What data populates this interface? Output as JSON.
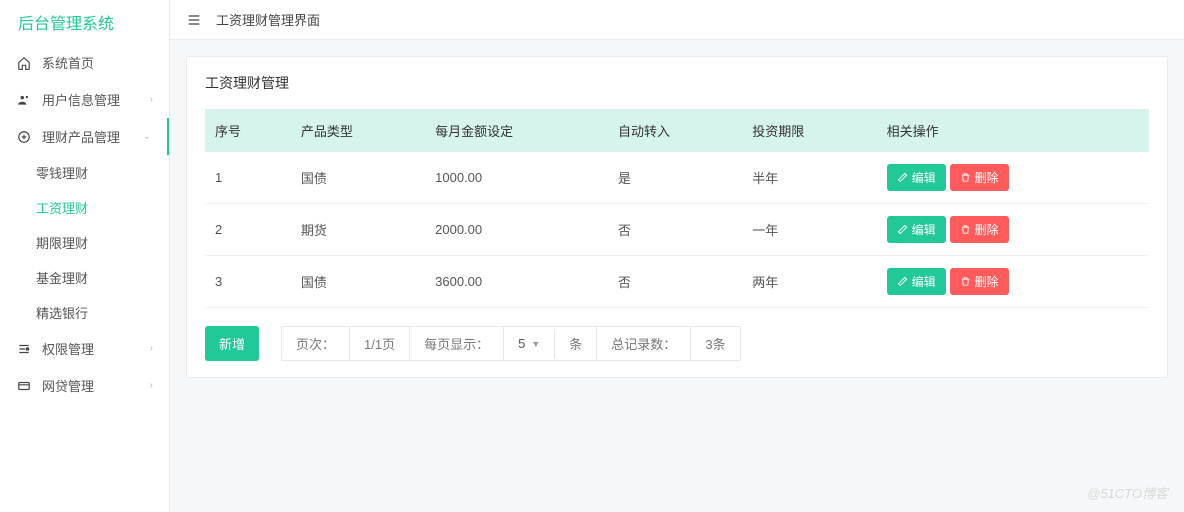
{
  "brand": "后台管理系统",
  "topbar": {
    "title": "工资理财管理界面"
  },
  "sidebar": {
    "home": "系统首页",
    "user": "用户信息管理",
    "product": "理财产品管理",
    "product_children": {
      "lingqian": "零钱理财",
      "gongzi": "工资理财",
      "qixian": "期限理财",
      "jijin": "基金理财",
      "jingxuan": "精选银行"
    },
    "perm": "权限管理",
    "loan": "网贷管理"
  },
  "card": {
    "title": "工资理财管理",
    "headers": {
      "seq": "序号",
      "type": "产品类型",
      "amount": "每月金额设定",
      "auto": "自动转入",
      "period": "投资期限",
      "ops": "相关操作"
    },
    "rows": [
      {
        "seq": "1",
        "type": "国债",
        "amount": "1000.00",
        "auto": "是",
        "period": "半年"
      },
      {
        "seq": "2",
        "type": "期货",
        "amount": "2000.00",
        "auto": "否",
        "period": "一年"
      },
      {
        "seq": "3",
        "type": "国债",
        "amount": "3600.00",
        "auto": "否",
        "period": "两年"
      }
    ],
    "buttons": {
      "edit": "编辑",
      "delete": "删除",
      "add": "新增"
    }
  },
  "pager": {
    "page_label": "页次：",
    "page_value": "1/1页",
    "per_page_label": "每页显示：",
    "per_page_value": "5",
    "per_page_unit": "条",
    "total_label": "总记录数：",
    "total_value": "3条"
  },
  "watermark": "@51CTO博客"
}
